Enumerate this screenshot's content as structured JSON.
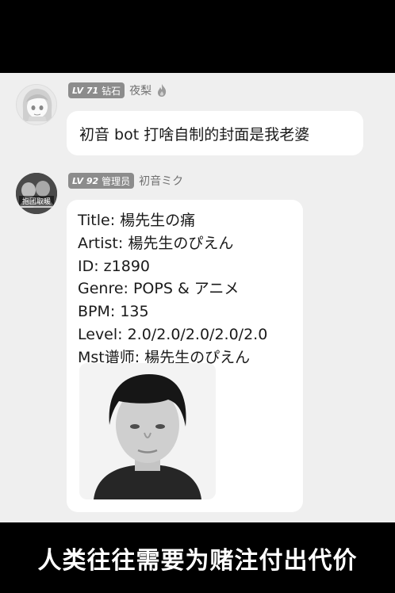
{
  "caption": "人类往往需要为赌注付出代价",
  "messages": [
    {
      "sender": {
        "level": "LV 71",
        "role": "钻石",
        "nickname": "夜梨"
      },
      "text": "初音 bot 打啥自制的封面是我老婆"
    },
    {
      "sender": {
        "level": "LV 92",
        "role": "管理员",
        "nickname": "初音ミク",
        "avatar_label": "抱团取暖"
      },
      "lines": [
        "Title: 楊先生の痛",
        "Artist: 楊先生のぴえん",
        "ID: z1890",
        "Genre: POPS & アニメ",
        "BPM: 135",
        "Level: 2.0/2.0/2.0/2.0/2.0",
        "Mst谱师: 楊先生のぴえん"
      ]
    }
  ],
  "colors": {
    "chat_background": "#efefef",
    "bubble": "#ffffff",
    "badge": "#8c8c8c",
    "caption_text": "#ffffff"
  }
}
